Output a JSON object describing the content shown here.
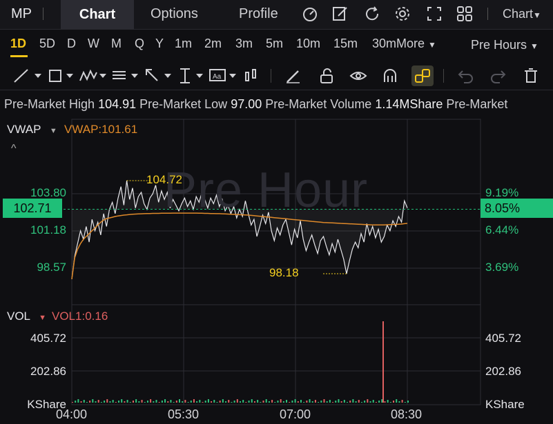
{
  "topbar": {
    "symbol": "MP",
    "tabs": [
      "Chart",
      "Options",
      "Profile"
    ],
    "chart_type": "Chart",
    "icons": [
      "gauge-icon",
      "edit-icon",
      "refresh-icon",
      "gear-icon",
      "fullscreen-icon",
      "grid-icon"
    ]
  },
  "intervals": [
    "1D",
    "5D",
    "D",
    "W",
    "M",
    "Q",
    "Y",
    "1m",
    "2m",
    "3m",
    "5m",
    "10m",
    "15m",
    "30m"
  ],
  "more_label": "More",
  "session_label": "Pre Hours",
  "info": {
    "high_label": "Pre-Market High",
    "high_value": "104.91",
    "low_label": "Pre-Market Low",
    "low_value": "97.00",
    "volume_label": "Pre-Market Volume",
    "volume_value": "1.14MShare",
    "trailing_label": "Pre-Market"
  },
  "main_panel": {
    "indicator": "VWAP",
    "indicator_value": "VWAP:101.61",
    "watermark": "Pre Hour",
    "current_price": "102.71",
    "current_pct": "8.05%",
    "y_left": [
      "103.80",
      "101.18",
      "98.57"
    ],
    "y_right": [
      "9.19%",
      "6.44%",
      "3.69%"
    ],
    "high_marker": "104.72",
    "low_marker": "98.18"
  },
  "volume_panel": {
    "indicator": "VOL",
    "indicator_value": "VOL1:0.16",
    "y_left": [
      "405.72",
      "202.86",
      "KShare"
    ],
    "y_right": [
      "405.72",
      "202.86",
      "KShare"
    ]
  },
  "x_labels": [
    "04:00",
    "05:30",
    "07:00",
    "08:30"
  ],
  "colors": {
    "accent": "#f5c518",
    "up": "#2fc27d",
    "vwap": "#e08a2a",
    "vol": "#e06060"
  },
  "chart_data": {
    "type": "line",
    "x_start": "04:00",
    "x_end": "08:30",
    "ylim": [
      97.0,
      105.9
    ],
    "price": [
      97.8,
      99.4,
      100.3,
      101.2,
      100.6,
      101.5,
      100.4,
      102.0,
      101.2,
      101.8,
      100.9,
      102.4,
      101.5,
      102.7,
      103.2,
      102.4,
      103.5,
      104.3,
      103.0,
      104.72,
      103.4,
      104.2,
      102.8,
      103.6,
      103.9,
      103.1,
      102.7,
      103.5,
      103.8,
      104.4,
      103.2,
      104.0,
      103.4,
      103.9,
      102.8,
      103.4,
      103.0,
      102.6,
      103.1,
      103.5,
      102.9,
      103.3,
      102.7,
      103.6,
      103.2,
      103.9,
      103.4,
      102.8,
      103.5,
      103.1,
      103.7,
      102.9,
      103.4,
      102.6,
      103.0,
      102.4,
      102.9,
      102.1,
      102.7,
      102.2,
      103.3,
      102.4,
      101.6,
      102.0,
      100.8,
      101.5,
      102.3,
      101.7,
      102.5,
      101.2,
      100.5,
      101.4,
      100.9,
      101.6,
      102.0,
      101.1,
      100.2,
      101.3,
      100.7,
      101.9,
      100.6,
      99.8,
      100.4,
      100.9,
      100.2,
      99.6,
      100.5,
      100.8,
      100.1,
      99.5,
      100.3,
      99.7,
      100.6,
      99.9,
      99.2,
      98.18,
      99.1,
      99.9,
      100.4,
      100.0,
      101.0,
      100.4,
      101.7,
      100.9,
      101.5,
      100.7,
      101.3,
      100.4,
      100.8,
      101.6,
      101.2,
      101.9,
      101.5,
      102.2,
      101.8,
      103.3,
      102.8
    ],
    "vwap": [
      97.8,
      99.3,
      99.9,
      100.3,
      100.6,
      100.8,
      101.0,
      101.2,
      101.4,
      101.6,
      101.8,
      101.95,
      102.05,
      102.1,
      102.15,
      102.2,
      102.24,
      102.27,
      102.3,
      102.32,
      102.34,
      102.36,
      102.37,
      102.38,
      102.39,
      102.4,
      102.41,
      102.41,
      102.42,
      102.42,
      102.42,
      102.43,
      102.43,
      102.43,
      102.43,
      102.44,
      102.44,
      102.44,
      102.44,
      102.44,
      102.44,
      102.44,
      102.44,
      102.44,
      102.43,
      102.43,
      102.42,
      102.42,
      102.41,
      102.41,
      102.4,
      102.4,
      102.39,
      102.38,
      102.37,
      102.36,
      102.35,
      102.34,
      102.33,
      102.32,
      102.31,
      102.3,
      102.28,
      102.26,
      102.24,
      102.22,
      102.2,
      102.18,
      102.16,
      102.14,
      102.12,
      102.1,
      102.08,
      102.06,
      102.04,
      102.02,
      102.0,
      101.98,
      101.96,
      101.94,
      101.92,
      101.9,
      101.88,
      101.86,
      101.84,
      101.82,
      101.8,
      101.78,
      101.77,
      101.76,
      101.75,
      101.74,
      101.73,
      101.72,
      101.71,
      101.7,
      101.69,
      101.68,
      101.67,
      101.66,
      101.65,
      101.64,
      101.63,
      101.62,
      101.61,
      101.61,
      101.61,
      101.61,
      101.61,
      101.62,
      101.63,
      101.64,
      101.65,
      101.66,
      101.67,
      101.7,
      101.72
    ],
    "volume_spike": {
      "time": "08:10",
      "value": 1.0
    }
  }
}
